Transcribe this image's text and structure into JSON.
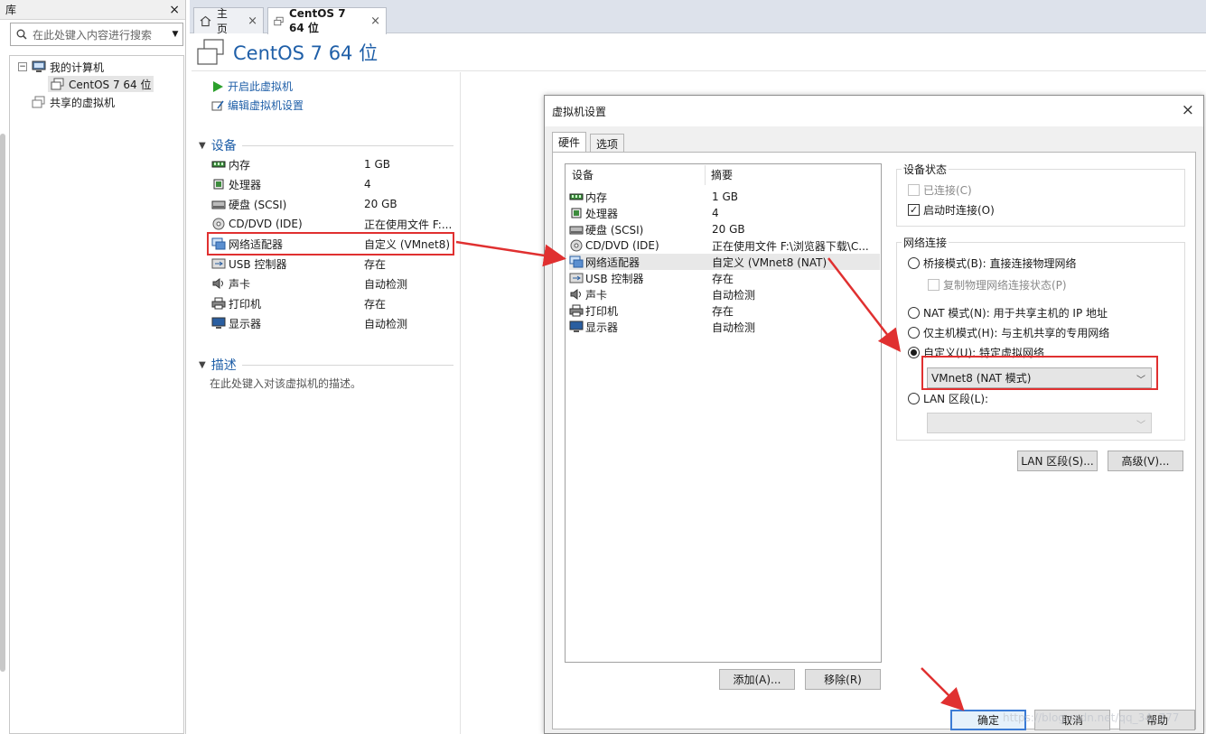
{
  "library": {
    "title": "库",
    "close": "×",
    "search_placeholder": "在此处键入内容进行搜索",
    "tree": [
      {
        "label": "我的计算机",
        "expander": "⊟"
      },
      {
        "label": "CentOS 7 64 位"
      },
      {
        "label": "共享的虚拟机"
      }
    ]
  },
  "tabs": [
    {
      "label": "主页",
      "close": "×"
    },
    {
      "label": "CentOS 7 64 位",
      "close": "×"
    }
  ],
  "vm": {
    "title": "CentOS 7 64 位",
    "actions": [
      "开启此虚拟机",
      "编辑虚拟机设置"
    ],
    "devices_section": "设备",
    "devices": [
      {
        "name": "内存",
        "value": "1 GB",
        "icon": "memory-icon"
      },
      {
        "name": "处理器",
        "value": "4",
        "icon": "cpu-icon"
      },
      {
        "name": "硬盘 (SCSI)",
        "value": "20 GB",
        "icon": "harddisk-icon"
      },
      {
        "name": "CD/DVD (IDE)",
        "value": "正在使用文件 F:...",
        "icon": "cdrom-icon"
      },
      {
        "name": "网络适配器",
        "value": "自定义 (VMnet8)",
        "icon": "network-icon"
      },
      {
        "name": "USB 控制器",
        "value": "存在",
        "icon": "usb-icon"
      },
      {
        "name": "声卡",
        "value": "自动检测",
        "icon": "sound-icon"
      },
      {
        "name": "打印机",
        "value": "存在",
        "icon": "printer-icon"
      },
      {
        "name": "显示器",
        "value": "自动检测",
        "icon": "display-icon"
      }
    ],
    "description_section": "描述",
    "description_placeholder": "在此处键入对该虚拟机的描述。"
  },
  "dialog": {
    "title": "虚拟机设置",
    "close": "×",
    "tabs": [
      "硬件",
      "选项"
    ],
    "list_headers": [
      "设备",
      "摘要"
    ],
    "devices": [
      {
        "name": "内存",
        "value": "1 GB"
      },
      {
        "name": "处理器",
        "value": "4"
      },
      {
        "name": "硬盘 (SCSI)",
        "value": "20 GB"
      },
      {
        "name": "CD/DVD (IDE)",
        "value": "正在使用文件 F:\\浏览器下载\\C..."
      },
      {
        "name": "网络适配器",
        "value": "自定义 (VMnet8 (NAT)"
      },
      {
        "name": "USB 控制器",
        "value": "存在"
      },
      {
        "name": "声卡",
        "value": "自动检测"
      },
      {
        "name": "打印机",
        "value": "存在"
      },
      {
        "name": "显示器",
        "value": "自动检测"
      }
    ],
    "add_button": "添加(A)...",
    "remove_button": "移除(R)",
    "device_status": {
      "label": "设备状态",
      "connected": "已连接(C)",
      "connect_on_power": "启动时连接(O)"
    },
    "network": {
      "label": "网络连接",
      "bridged": "桥接模式(B): 直接连接物理网络",
      "replicate": "复制物理网络连接状态(P)",
      "nat": "NAT 模式(N): 用于共享主机的 IP 地址",
      "host_only": "仅主机模式(H): 与主机共享的专用网络",
      "custom": "自定义(U): 特定虚拟网络",
      "custom_value": "VMnet8 (NAT 模式)",
      "lan": "LAN 区段(L):",
      "lan_value": ""
    },
    "lan_segments_button": "LAN 区段(S)...",
    "advanced_button": "高级(V)...",
    "ok_button": "确定",
    "cancel_button": "取消",
    "help_button": "帮助"
  },
  "watermark": "https://blog.csdn.net/qq_34..777",
  "colors": {
    "accent": "#1f5fa8",
    "highlight": "#e03030"
  }
}
